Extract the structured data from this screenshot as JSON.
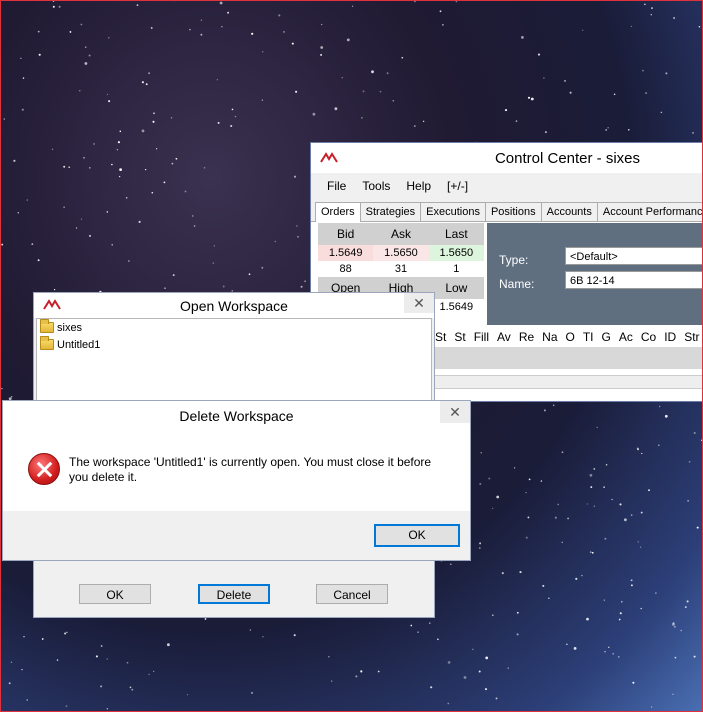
{
  "control_center": {
    "title": "Control Center - sixes",
    "menu": [
      "File",
      "Tools",
      "Help",
      "[+/-]"
    ],
    "tabs": [
      "Orders",
      "Strategies",
      "Executions",
      "Positions",
      "Accounts",
      "Account Performance"
    ],
    "active_tab": "Orders",
    "quote": {
      "headers": [
        "Bid",
        "Ask",
        "Last"
      ],
      "prices": [
        "1.5649",
        "1.5650",
        "1.5650"
      ],
      "sizes": [
        "88",
        "31",
        "1"
      ],
      "headers2": [
        "Open",
        "High",
        "Low"
      ],
      "values2": [
        "",
        "",
        "1.5649"
      ]
    },
    "type_label": "Type:",
    "type_value": "<Default>",
    "name_label": "Name:",
    "name_value": "6B 12-14",
    "columns": [
      "St",
      "St",
      "Fill",
      "Av",
      "Re",
      "Na",
      "O",
      "TI",
      "G",
      "Ac",
      "Co",
      "ID",
      "Str"
    ]
  },
  "open_workspace": {
    "title": "Open Workspace",
    "items": [
      "sixes",
      "Untitled1"
    ],
    "ok_label": "OK",
    "delete_label": "Delete",
    "cancel_label": "Cancel"
  },
  "delete_workspace": {
    "title": "Delete Workspace",
    "message": "The workspace 'Untitled1' is currently open. You must close it before you delete it.",
    "ok_label": "OK"
  },
  "colors": {
    "error_red": "#d21d1d",
    "focus_blue": "#0078d7",
    "screen_border": "#e0323c"
  }
}
